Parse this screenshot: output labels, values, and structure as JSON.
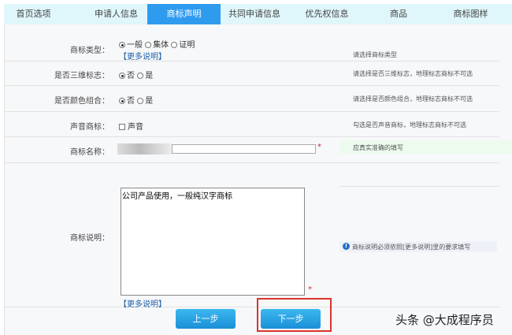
{
  "tabs": [
    "首页选项",
    "申请人信息",
    "商标声明",
    "共同申请信息",
    "优先权信息",
    "商品",
    "商标图样"
  ],
  "form": {
    "type": {
      "label": "商标类型：",
      "options": [
        "一般",
        "集体",
        "证明"
      ],
      "selected": "一般",
      "more": "【更多说明】",
      "hint": "请选择商标类型"
    },
    "three_d": {
      "label": "是否三维标志：",
      "options": [
        "否",
        "是"
      ],
      "selected": "否",
      "hint": "请选择是否三维标志，地理标志商标不可选"
    },
    "color": {
      "label": "是否颜色组合：",
      "options": [
        "否",
        "是"
      ],
      "selected": "否",
      "hint": "请选择是否颜色组合，地理标志商标不可选"
    },
    "sound": {
      "label": "声音商标：",
      "option": "声音",
      "checked": false,
      "hint": "勾选是否声音商标，地理标志商标不可选"
    },
    "name": {
      "label": "商标名称：",
      "value": "",
      "required": "*",
      "hint": "应真实准确的填写"
    },
    "desc": {
      "label": "商标说明：",
      "value": "公司产品使用，一般纯汉字商标",
      "required": "*",
      "more": "【更多说明】",
      "hint": "商标说明必须依照[更多说明]里的要求填写"
    }
  },
  "buttons": {
    "prev": "上一步",
    "next": "下一步"
  },
  "watermark": "头条 @大成程序员"
}
